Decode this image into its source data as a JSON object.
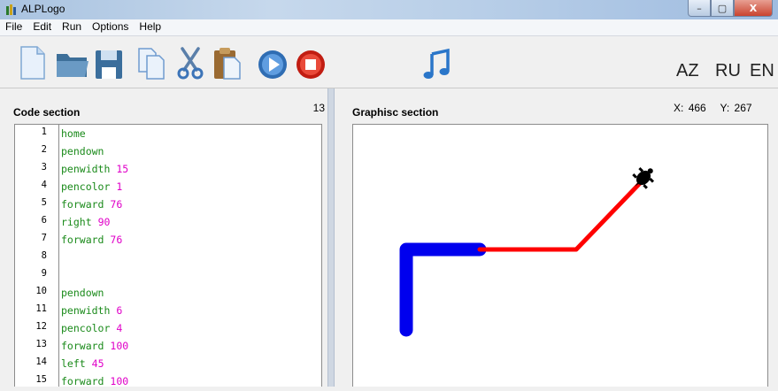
{
  "window": {
    "title": "ALPLogo",
    "buttons": {
      "minimize": "–",
      "maximize": "▢",
      "close": "X"
    }
  },
  "menu": [
    "File",
    "Edit",
    "Run",
    "Options",
    "Help"
  ],
  "toolbar": {
    "icons": [
      "new-file-icon",
      "open-folder-icon",
      "save-icon",
      "copy-icon",
      "cut-icon",
      "paste-icon",
      "run-icon",
      "stop-icon",
      "music-icon"
    ],
    "languages": [
      "AZ",
      "RU",
      "EN"
    ]
  },
  "code_section": {
    "title": "Code section",
    "line_count": "13",
    "lines": [
      {
        "n": "1",
        "cmd": "home",
        "arg": ""
      },
      {
        "n": "2",
        "cmd": "pendown",
        "arg": ""
      },
      {
        "n": "3",
        "cmd": "penwidth",
        "arg": "15"
      },
      {
        "n": "4",
        "cmd": "pencolor",
        "arg": "1"
      },
      {
        "n": "5",
        "cmd": "forward",
        "arg": "76"
      },
      {
        "n": "6",
        "cmd": "right",
        "arg": "90"
      },
      {
        "n": "7",
        "cmd": "forward",
        "arg": "76"
      },
      {
        "n": "8",
        "cmd": "",
        "arg": ""
      },
      {
        "n": "9",
        "cmd": "",
        "arg": ""
      },
      {
        "n": "10",
        "cmd": "pendown",
        "arg": ""
      },
      {
        "n": "11",
        "cmd": "penwidth",
        "arg": "6"
      },
      {
        "n": "12",
        "cmd": "pencolor",
        "arg": "4"
      },
      {
        "n": "13",
        "cmd": "forward",
        "arg": "100"
      },
      {
        "n": "14",
        "cmd": "left",
        "arg": "45"
      },
      {
        "n": "15",
        "cmd": "forward",
        "arg": "100"
      }
    ]
  },
  "graphics_section": {
    "title": "Graphisc section",
    "x_label": "X:",
    "x_value": "466",
    "y_label": "Y:",
    "y_value": "267"
  },
  "colors": {
    "blue_pen": "#0000ee",
    "red_pen": "#ff0000",
    "code_command": "#1a8a1a",
    "code_argument": "#e000c8",
    "turtle": "#000000"
  }
}
